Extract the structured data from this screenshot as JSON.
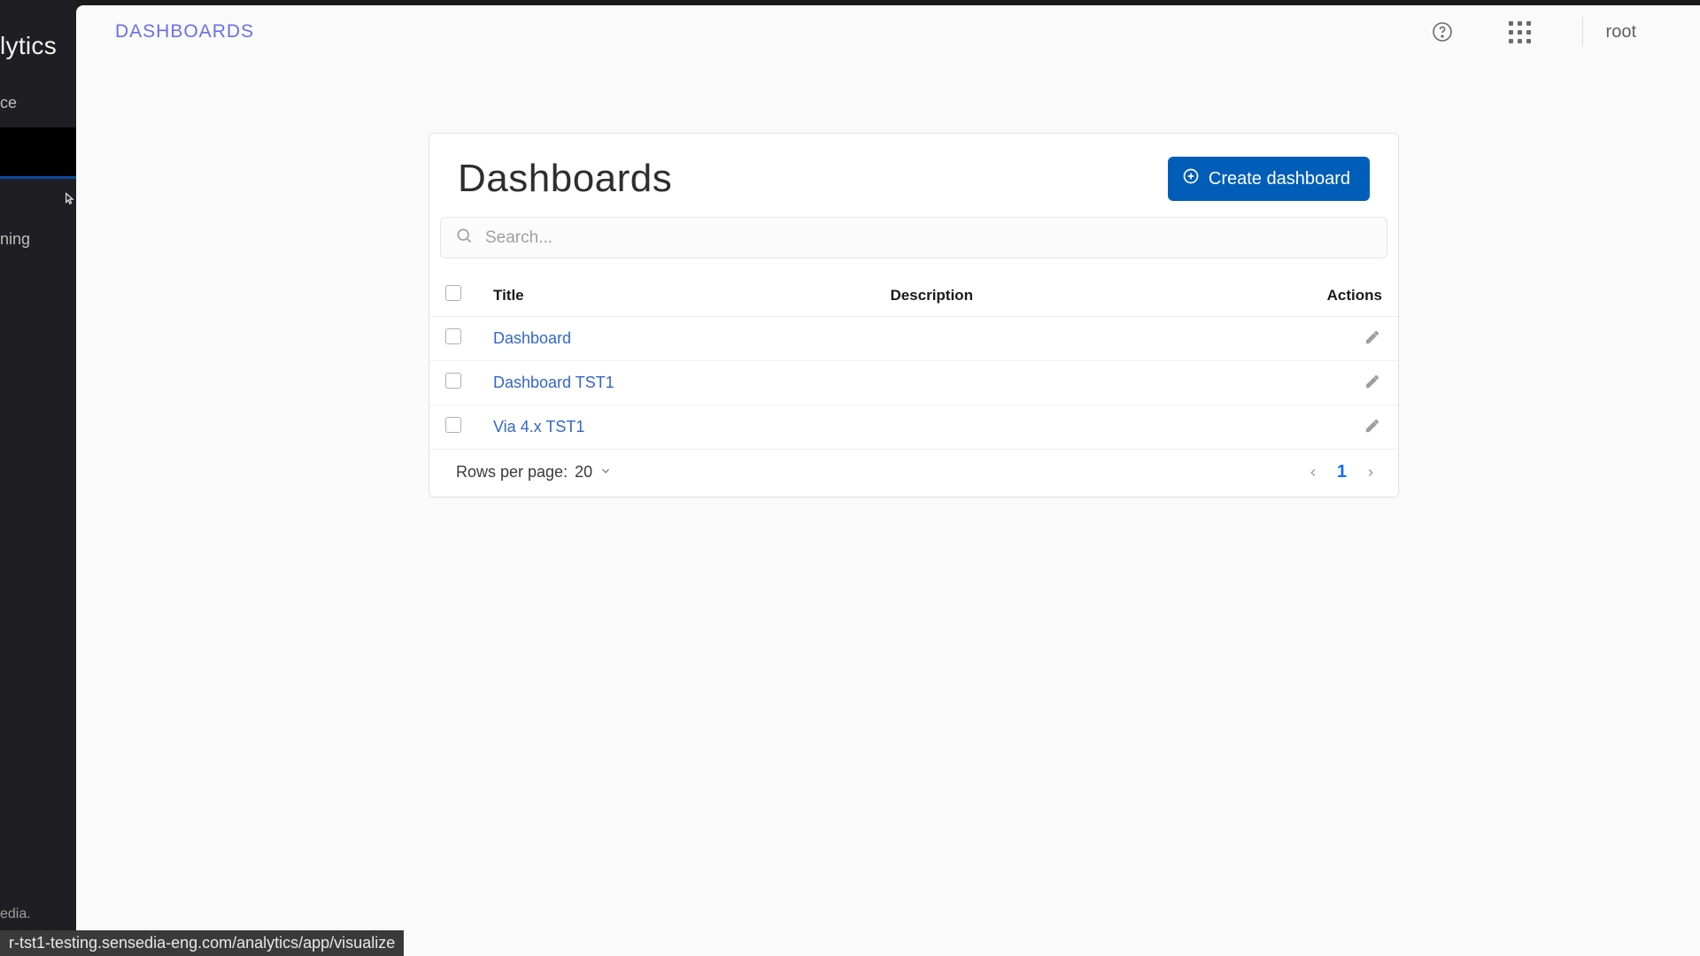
{
  "sidebar": {
    "brand_fragment": "lytics",
    "items": [
      {
        "label_fragment": "ce"
      },
      {
        "label_fragment": ""
      },
      {
        "label_fragment": "ning"
      }
    ],
    "footer_fragment": "edia."
  },
  "topbar": {
    "breadcrumb": "DASHBOARDS",
    "user": "root"
  },
  "page": {
    "title": "Dashboards",
    "create_button": "Create dashboard",
    "search_placeholder": "Search...",
    "columns": {
      "title": "Title",
      "description": "Description",
      "actions": "Actions"
    },
    "rows": [
      {
        "title": "Dashboard",
        "description": ""
      },
      {
        "title": "Dashboard TST1",
        "description": ""
      },
      {
        "title": "Via 4.x TST1",
        "description": ""
      }
    ],
    "rows_per_page_label": "Rows per page: ",
    "rows_per_page_value": "20",
    "current_page": "1"
  },
  "status_url": "r-tst1-testing.sensedia-eng.com/analytics/app/visualize"
}
